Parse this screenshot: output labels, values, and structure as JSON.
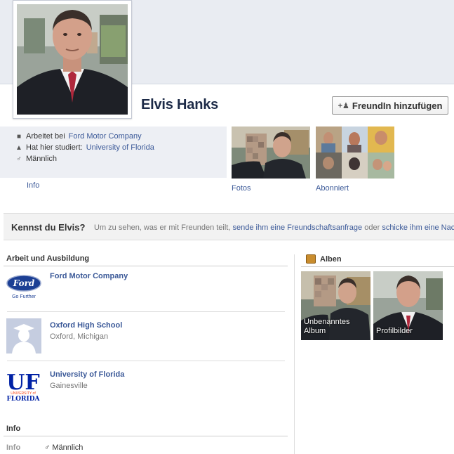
{
  "profile": {
    "name": "Elvis Hanks",
    "add_friend_label": "FreundIn hinzufügen"
  },
  "intro": {
    "work_prefix": "Arbeitet bei",
    "work_link": "Ford Motor Company",
    "study_prefix": "Hat hier studiert:",
    "study_link": "University of Florida",
    "gender": "Männlich",
    "info_tab": "Info"
  },
  "thumbs": {
    "photos_label": "Fotos",
    "subscribed_label": "Abonniert"
  },
  "know_bar": {
    "question": "Kennst du Elvis?",
    "text_1": "Um zu sehen, was er mit Freunden teilt,",
    "link_1": "sende ihm eine Freundschaftsanfrage",
    "text_2": "oder",
    "link_2": "schicke ihm eine Nachricht"
  },
  "work_edu": {
    "title": "Arbeit und Ausbildung",
    "items": [
      {
        "name": "Ford Motor Company",
        "sub": "",
        "logo_text": "Ford",
        "logo_tagline": "Go Further"
      },
      {
        "name": "Oxford High School",
        "sub": "Oxford, Michigan"
      },
      {
        "name": "University of Florida",
        "sub": "Gainesville",
        "logo_text": "UF",
        "logo_small": "UNIVERSITY of",
        "logo_big": "FLORIDA"
      }
    ]
  },
  "albums": {
    "title": "Alben",
    "items": [
      {
        "label": "Unbenanntes Album"
      },
      {
        "label": "Profilbilder"
      }
    ]
  },
  "bottom_info": {
    "title": "Info",
    "key": "Info",
    "value": "Männlich"
  },
  "colors": {
    "link": "#3b5998",
    "cover": "#e9ecf2",
    "info_box": "#edeff4",
    "ford_blue": "#1c3f94",
    "uf_blue": "#0021a5",
    "uf_orange": "#fa4616"
  }
}
